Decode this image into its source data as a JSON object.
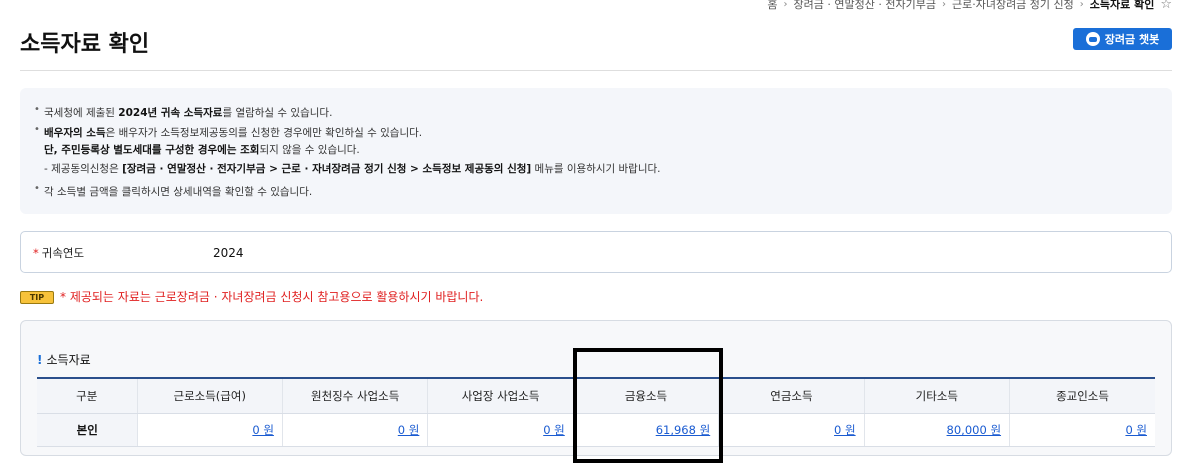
{
  "breadcrumb": {
    "items": [
      "홈",
      "장려금 · 연말정산 · 전자기부금",
      "근로·자녀장려금 정기 신청",
      "소득자료 확인"
    ]
  },
  "page": {
    "title": "소득자료 확인",
    "chatbot_label": "장려금 챗봇"
  },
  "notice": {
    "l1_a": "국세청에 제출된 ",
    "l1_b": "2024년 귀속 소득자료",
    "l1_c": "를 열람하실 수 있습니다.",
    "l2_a": "배우자의 소득",
    "l2_b": "은 배우자가 소득정보제공동의를 신청한 경우에만 확인하실 수 있습니다.",
    "l3_a": "단, 주민등록상 별도세대를 구성한 경우에는 조회",
    "l3_b": "되지 않을 수 있습니다.",
    "l4_a": "- 제공동의신청은 ",
    "l4_b": "[장려금 · 연말정산 · 전자기부금 > 근로 · 자녀장려금 정기 신청 > 소득정보 제공동의 신청]",
    "l4_c": " 메뉴를 이용하시기 바랍니다.",
    "l5": "각 소득별 금액을 클릭하시면 상세내역을 확인할 수 있습니다."
  },
  "year_field": {
    "required_mark": "*",
    "label": "귀속연도",
    "value": "2024"
  },
  "tip": {
    "badge": "TIP",
    "text": "* 제공되는 자료는 근로장려금 · 자녀장려금 신청시 참고용으로 활용하시기 바랍니다."
  },
  "income": {
    "section_mark": "!",
    "section_title": "소득자료",
    "columns": [
      "구분",
      "근로소득(급여)",
      "원천징수 사업소득",
      "사업장 사업소득",
      "금융소득",
      "연금소득",
      "기타소득",
      "종교인소득"
    ],
    "row": {
      "label": "본인",
      "values": [
        "0 원",
        "0 원",
        "0 원",
        "61,968 원",
        "0 원",
        "80,000 원",
        "0 원"
      ]
    }
  },
  "colors": {
    "accent": "#1a6fd8",
    "table_border": "#2b4f8c",
    "warning": "#e02020",
    "tip_badge": "#f7c23a"
  }
}
